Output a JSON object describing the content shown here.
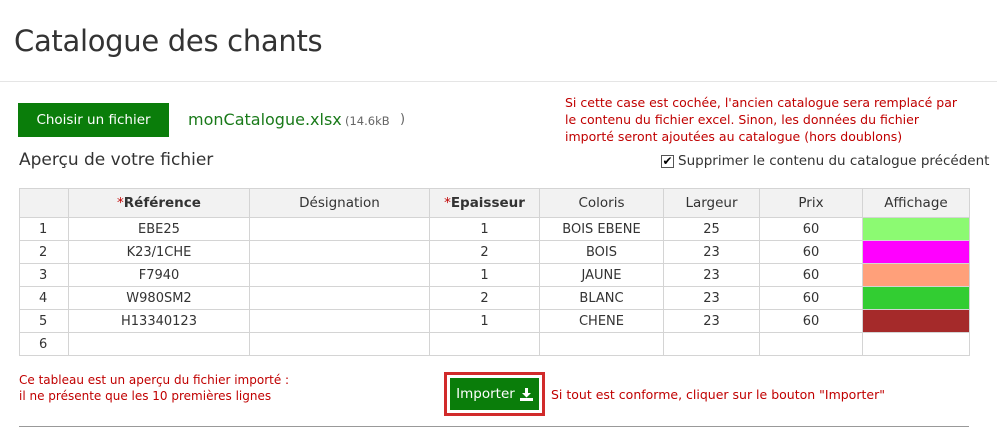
{
  "page": {
    "title": "Catalogue des chants"
  },
  "file": {
    "choose_label": "Choisir un fichier",
    "name": "monCatalogue.xlsx",
    "size": "(14.6kB",
    "size_close": ")"
  },
  "warning": "Si cette case est cochée, l'ancien catalogue sera remplacé par le contenu du fichier excel. Sinon, les données du fichier importé seront ajoutées au catalogue (hors doublons)",
  "preview": {
    "title": "Aperçu de votre fichier",
    "checkbox_label": "Supprimer le contenu du catalogue précédent",
    "checkbox_checked": true
  },
  "table": {
    "columns": [
      {
        "label": "",
        "required": false
      },
      {
        "label": "Référence",
        "required": true
      },
      {
        "label": "Désignation",
        "required": false
      },
      {
        "label": "Epaisseur",
        "required": true
      },
      {
        "label": "Coloris",
        "required": false
      },
      {
        "label": "Largeur",
        "required": false
      },
      {
        "label": "Prix",
        "required": false
      },
      {
        "label": "Affichage",
        "required": false
      }
    ],
    "rows": [
      {
        "idx": "1",
        "reference": "EBE25",
        "designation": "",
        "epaisseur": "1",
        "coloris": "BOIS EBENE",
        "largeur": "25",
        "prix": "60",
        "affichage": "#8cfa72"
      },
      {
        "idx": "2",
        "reference": "K23/1CHE",
        "designation": "",
        "epaisseur": "2",
        "coloris": "BOIS",
        "largeur": "23",
        "prix": "60",
        "affichage": "#ff00ff"
      },
      {
        "idx": "3",
        "reference": "F7940",
        "designation": "",
        "epaisseur": "1",
        "coloris": "JAUNE",
        "largeur": "23",
        "prix": "60",
        "affichage": "#ffa07a"
      },
      {
        "idx": "4",
        "reference": "W980SM2",
        "designation": "",
        "epaisseur": "2",
        "coloris": "BLANC",
        "largeur": "23",
        "prix": "60",
        "affichage": "#32cd32"
      },
      {
        "idx": "5",
        "reference": "H13340123",
        "designation": "",
        "epaisseur": "1",
        "coloris": "CHENE",
        "largeur": "23",
        "prix": "60",
        "affichage": "#a52a2a"
      },
      {
        "idx": "6",
        "reference": "",
        "designation": "",
        "epaisseur": "",
        "coloris": "",
        "largeur": "",
        "prix": "",
        "affichage": ""
      }
    ]
  },
  "footer": {
    "note_line1": "Ce tableau est un aperçu du fichier importé :",
    "note_line2": "il ne présente que les 10 premières lignes",
    "import_label": "Importer",
    "import_icon": "download-icon",
    "import_hint": "Si tout est conforme, cliquer sur le bouton \"Importer\""
  },
  "colors": {
    "primary_green": "#0a7d0a",
    "warning_red": "#c00000",
    "highlight_border": "#d12a2a"
  }
}
